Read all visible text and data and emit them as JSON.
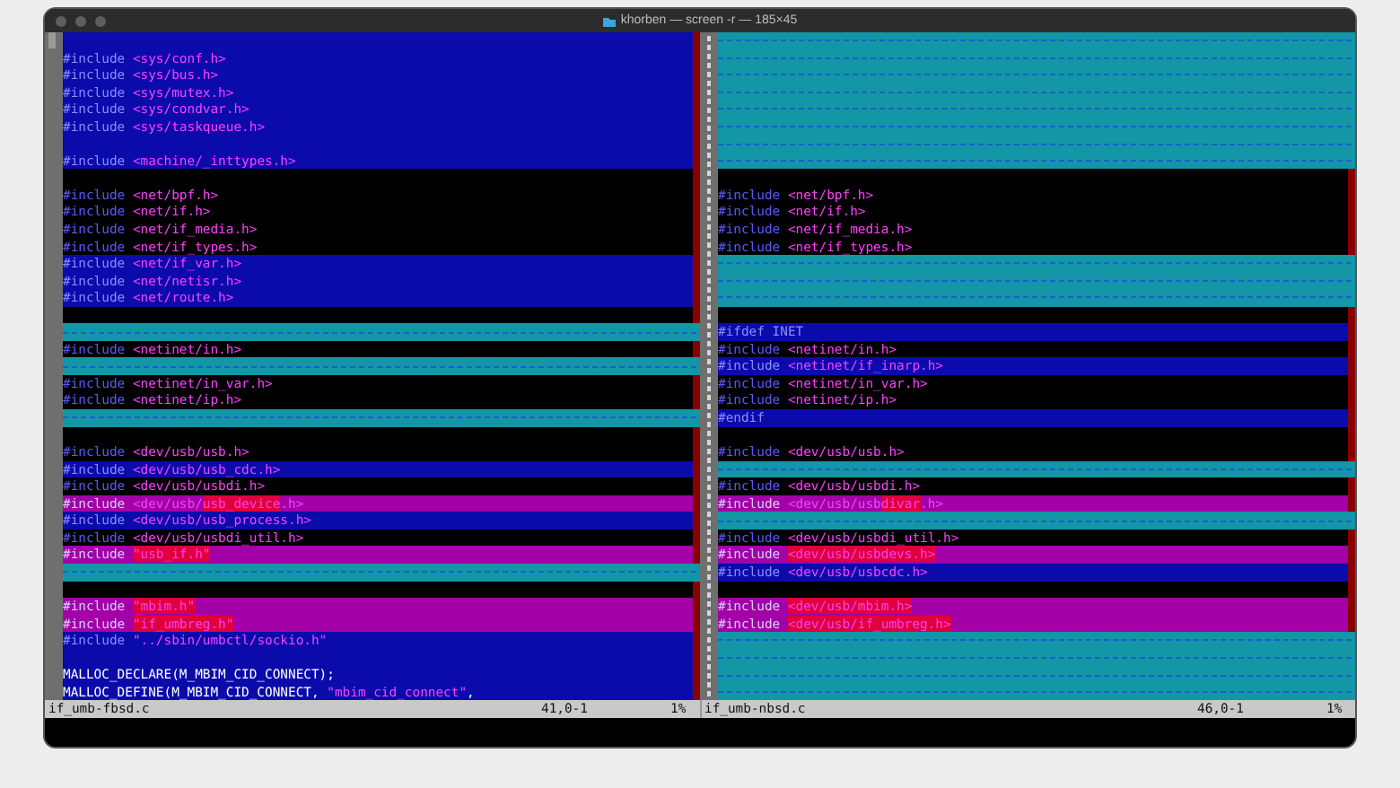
{
  "window": {
    "title": "khorben — screen -r — 185×45"
  },
  "panes": [
    {
      "file": "if_umb-fbsd.c",
      "position": "41,0-1",
      "percent": "1%",
      "lines": [
        {
          "kind": "add",
          "cursor": true
        },
        {
          "kind": "add",
          "tokens": [
            {
              "kind": "preproc",
              "text": "#include"
            },
            {
              "kind": "string",
              "text": "<sys/conf.h>"
            }
          ]
        },
        {
          "kind": "add",
          "tokens": [
            {
              "kind": "preproc",
              "text": "#include"
            },
            {
              "kind": "string",
              "text": "<sys/bus.h>"
            }
          ]
        },
        {
          "kind": "add",
          "tokens": [
            {
              "kind": "preproc",
              "text": "#include"
            },
            {
              "kind": "string",
              "text": "<sys/mutex.h>"
            }
          ]
        },
        {
          "kind": "add",
          "tokens": [
            {
              "kind": "preproc",
              "text": "#include"
            },
            {
              "kind": "string",
              "text": "<sys/condvar.h>"
            }
          ]
        },
        {
          "kind": "add",
          "tokens": [
            {
              "kind": "preproc",
              "text": "#include"
            },
            {
              "kind": "string",
              "text": "<sys/taskqueue.h>"
            }
          ]
        },
        {
          "kind": "add"
        },
        {
          "kind": "add",
          "tokens": [
            {
              "kind": "preproc",
              "text": "#include"
            },
            {
              "kind": "string",
              "text": "<machine/_inttypes.h>"
            }
          ]
        },
        {
          "kind": "same"
        },
        {
          "kind": "same",
          "tokens": [
            {
              "kind": "preproc",
              "text": "#include"
            },
            {
              "kind": "string",
              "text": "<net/bpf.h>"
            }
          ]
        },
        {
          "kind": "same",
          "tokens": [
            {
              "kind": "preproc",
              "text": "#include"
            },
            {
              "kind": "string",
              "text": "<net/if.h>"
            }
          ]
        },
        {
          "kind": "same",
          "tokens": [
            {
              "kind": "preproc",
              "text": "#include"
            },
            {
              "kind": "string",
              "text": "<net/if_media.h>"
            }
          ]
        },
        {
          "kind": "same",
          "tokens": [
            {
              "kind": "preproc",
              "text": "#include"
            },
            {
              "kind": "string",
              "text": "<net/if_types.h>"
            }
          ]
        },
        {
          "kind": "add",
          "tokens": [
            {
              "kind": "preproc",
              "text": "#include"
            },
            {
              "kind": "string",
              "text": "<net/if_var.h>"
            }
          ]
        },
        {
          "kind": "add",
          "tokens": [
            {
              "kind": "preproc",
              "text": "#include"
            },
            {
              "kind": "string",
              "text": "<net/netisr.h>"
            }
          ]
        },
        {
          "kind": "add",
          "tokens": [
            {
              "kind": "preproc",
              "text": "#include"
            },
            {
              "kind": "string",
              "text": "<net/route.h>"
            }
          ]
        },
        {
          "kind": "same"
        },
        {
          "kind": "filler"
        },
        {
          "kind": "same",
          "tokens": [
            {
              "kind": "preproc",
              "text": "#include"
            },
            {
              "kind": "string",
              "text": "<netinet/in.h>"
            }
          ]
        },
        {
          "kind": "filler"
        },
        {
          "kind": "same",
          "tokens": [
            {
              "kind": "preproc",
              "text": "#include"
            },
            {
              "kind": "string",
              "text": "<netinet/in_var.h>"
            }
          ]
        },
        {
          "kind": "same",
          "tokens": [
            {
              "kind": "preproc",
              "text": "#include"
            },
            {
              "kind": "string",
              "text": "<netinet/ip.h>"
            }
          ]
        },
        {
          "kind": "filler"
        },
        {
          "kind": "same"
        },
        {
          "kind": "same",
          "tokens": [
            {
              "kind": "preproc",
              "text": "#include"
            },
            {
              "kind": "string",
              "text": "<dev/usb/usb.h>"
            }
          ]
        },
        {
          "kind": "add",
          "tokens": [
            {
              "kind": "preproc",
              "text": "#include"
            },
            {
              "kind": "string",
              "text": "<dev/usb/usb_cdc.h>"
            }
          ]
        },
        {
          "kind": "same",
          "tokens": [
            {
              "kind": "preproc",
              "text": "#include"
            },
            {
              "kind": "string",
              "text": "<dev/usb/usbdi.h>"
            }
          ]
        },
        {
          "kind": "change",
          "tokens": [
            {
              "kind": "preproc",
              "text": "#include"
            },
            {
              "kind": "string",
              "text": "<dev/usb/"
            },
            {
              "kind": "string",
              "text": "usb_device",
              "changed": true
            },
            {
              "kind": "string",
              "text": ".h>"
            }
          ]
        },
        {
          "kind": "add",
          "tokens": [
            {
              "kind": "preproc",
              "text": "#include"
            },
            {
              "kind": "string",
              "text": "<dev/usb/usb_process.h>"
            }
          ]
        },
        {
          "kind": "same",
          "tokens": [
            {
              "kind": "preproc",
              "text": "#include"
            },
            {
              "kind": "string",
              "text": "<dev/usb/usbdi_util.h>"
            }
          ]
        },
        {
          "kind": "change",
          "tokens": [
            {
              "kind": "preproc",
              "text": "#include"
            },
            {
              "kind": "string",
              "text": "\"usb_if.h\"",
              "changed": true
            }
          ]
        },
        {
          "kind": "filler"
        },
        {
          "kind": "same"
        },
        {
          "kind": "change",
          "tokens": [
            {
              "kind": "preproc",
              "text": "#include"
            },
            {
              "kind": "string",
              "text": "\"mbim.h\"",
              "changed": true
            }
          ]
        },
        {
          "kind": "change",
          "tokens": [
            {
              "kind": "preproc",
              "text": "#include"
            },
            {
              "kind": "string",
              "text": "\"if_umbreg.h\"",
              "changed": true
            }
          ]
        },
        {
          "kind": "add",
          "tokens": [
            {
              "kind": "preproc",
              "text": "#include"
            },
            {
              "kind": "string",
              "text": "\"../sbin/umbctl/sockio.h\""
            }
          ]
        },
        {
          "kind": "add"
        },
        {
          "kind": "add",
          "tokens": [
            {
              "kind": "plain",
              "text": "MALLOC_DECLARE(M_MBIM_CID_CONNECT);"
            }
          ]
        },
        {
          "kind": "add",
          "tokens": [
            {
              "kind": "plain",
              "text": "MALLOC_DEFINE(M_MBIM_CID_CONNECT,"
            },
            {
              "kind": "string",
              "text": "\"mbim_cid_connect\""
            },
            {
              "kind": "plain",
              "text": ","
            }
          ]
        }
      ]
    },
    {
      "file": "if_umb-nbsd.c",
      "position": "46,0-1",
      "percent": "1%",
      "lines": [
        {
          "kind": "filler"
        },
        {
          "kind": "filler"
        },
        {
          "kind": "filler"
        },
        {
          "kind": "filler"
        },
        {
          "kind": "filler"
        },
        {
          "kind": "filler"
        },
        {
          "kind": "filler"
        },
        {
          "kind": "filler"
        },
        {
          "kind": "same"
        },
        {
          "kind": "same",
          "tokens": [
            {
              "kind": "preproc",
              "text": "#include"
            },
            {
              "kind": "string",
              "text": "<net/bpf.h>"
            }
          ]
        },
        {
          "kind": "same",
          "tokens": [
            {
              "kind": "preproc",
              "text": "#include"
            },
            {
              "kind": "string",
              "text": "<net/if.h>"
            }
          ]
        },
        {
          "kind": "same",
          "tokens": [
            {
              "kind": "preproc",
              "text": "#include"
            },
            {
              "kind": "string",
              "text": "<net/if_media.h>"
            }
          ]
        },
        {
          "kind": "same",
          "tokens": [
            {
              "kind": "preproc",
              "text": "#include"
            },
            {
              "kind": "string",
              "text": "<net/if_types.h>"
            }
          ]
        },
        {
          "kind": "filler"
        },
        {
          "kind": "filler"
        },
        {
          "kind": "filler"
        },
        {
          "kind": "same"
        },
        {
          "kind": "add",
          "tokens": [
            {
              "kind": "preproc",
              "text": "#ifdef INET"
            }
          ]
        },
        {
          "kind": "same",
          "tokens": [
            {
              "kind": "preproc",
              "text": "#include"
            },
            {
              "kind": "string",
              "text": "<netinet/in.h>"
            }
          ]
        },
        {
          "kind": "add",
          "tokens": [
            {
              "kind": "preproc",
              "text": "#include"
            },
            {
              "kind": "string",
              "text": "<netinet/if_inarp.h>"
            }
          ]
        },
        {
          "kind": "same",
          "tokens": [
            {
              "kind": "preproc",
              "text": "#include"
            },
            {
              "kind": "string",
              "text": "<netinet/in_var.h>"
            }
          ]
        },
        {
          "kind": "same",
          "tokens": [
            {
              "kind": "preproc",
              "text": "#include"
            },
            {
              "kind": "string",
              "text": "<netinet/ip.h>"
            }
          ]
        },
        {
          "kind": "add",
          "tokens": [
            {
              "kind": "preproc",
              "text": "#endif"
            }
          ]
        },
        {
          "kind": "same"
        },
        {
          "kind": "same",
          "tokens": [
            {
              "kind": "preproc",
              "text": "#include"
            },
            {
              "kind": "string",
              "text": "<dev/usb/usb.h>"
            }
          ]
        },
        {
          "kind": "filler"
        },
        {
          "kind": "same",
          "tokens": [
            {
              "kind": "preproc",
              "text": "#include"
            },
            {
              "kind": "string",
              "text": "<dev/usb/usbdi.h>"
            }
          ]
        },
        {
          "kind": "change",
          "tokens": [
            {
              "kind": "preproc",
              "text": "#include"
            },
            {
              "kind": "string",
              "text": "<dev/usb/usb"
            },
            {
              "kind": "string",
              "text": "divar",
              "changed": true
            },
            {
              "kind": "string",
              "text": ".h>"
            }
          ]
        },
        {
          "kind": "filler"
        },
        {
          "kind": "same",
          "tokens": [
            {
              "kind": "preproc",
              "text": "#include"
            },
            {
              "kind": "string",
              "text": "<dev/usb/usbdi_util.h>"
            }
          ]
        },
        {
          "kind": "change",
          "tokens": [
            {
              "kind": "preproc",
              "text": "#include"
            },
            {
              "kind": "string",
              "text": "<dev/usb/usbdevs.h>",
              "changed": true
            }
          ]
        },
        {
          "kind": "add",
          "tokens": [
            {
              "kind": "preproc",
              "text": "#include"
            },
            {
              "kind": "string",
              "text": "<dev/usb/usbcdc.h>"
            }
          ]
        },
        {
          "kind": "same"
        },
        {
          "kind": "change",
          "tokens": [
            {
              "kind": "preproc",
              "text": "#include"
            },
            {
              "kind": "string",
              "text": "<dev/usb/mbim.h>",
              "changed": true
            }
          ]
        },
        {
          "kind": "change",
          "tokens": [
            {
              "kind": "preproc",
              "text": "#include"
            },
            {
              "kind": "string",
              "text": "<dev/usb/if_umbreg.h>",
              "changed": true
            }
          ]
        },
        {
          "kind": "filler"
        },
        {
          "kind": "filler"
        },
        {
          "kind": "filler"
        },
        {
          "kind": "filler"
        }
      ]
    }
  ]
}
